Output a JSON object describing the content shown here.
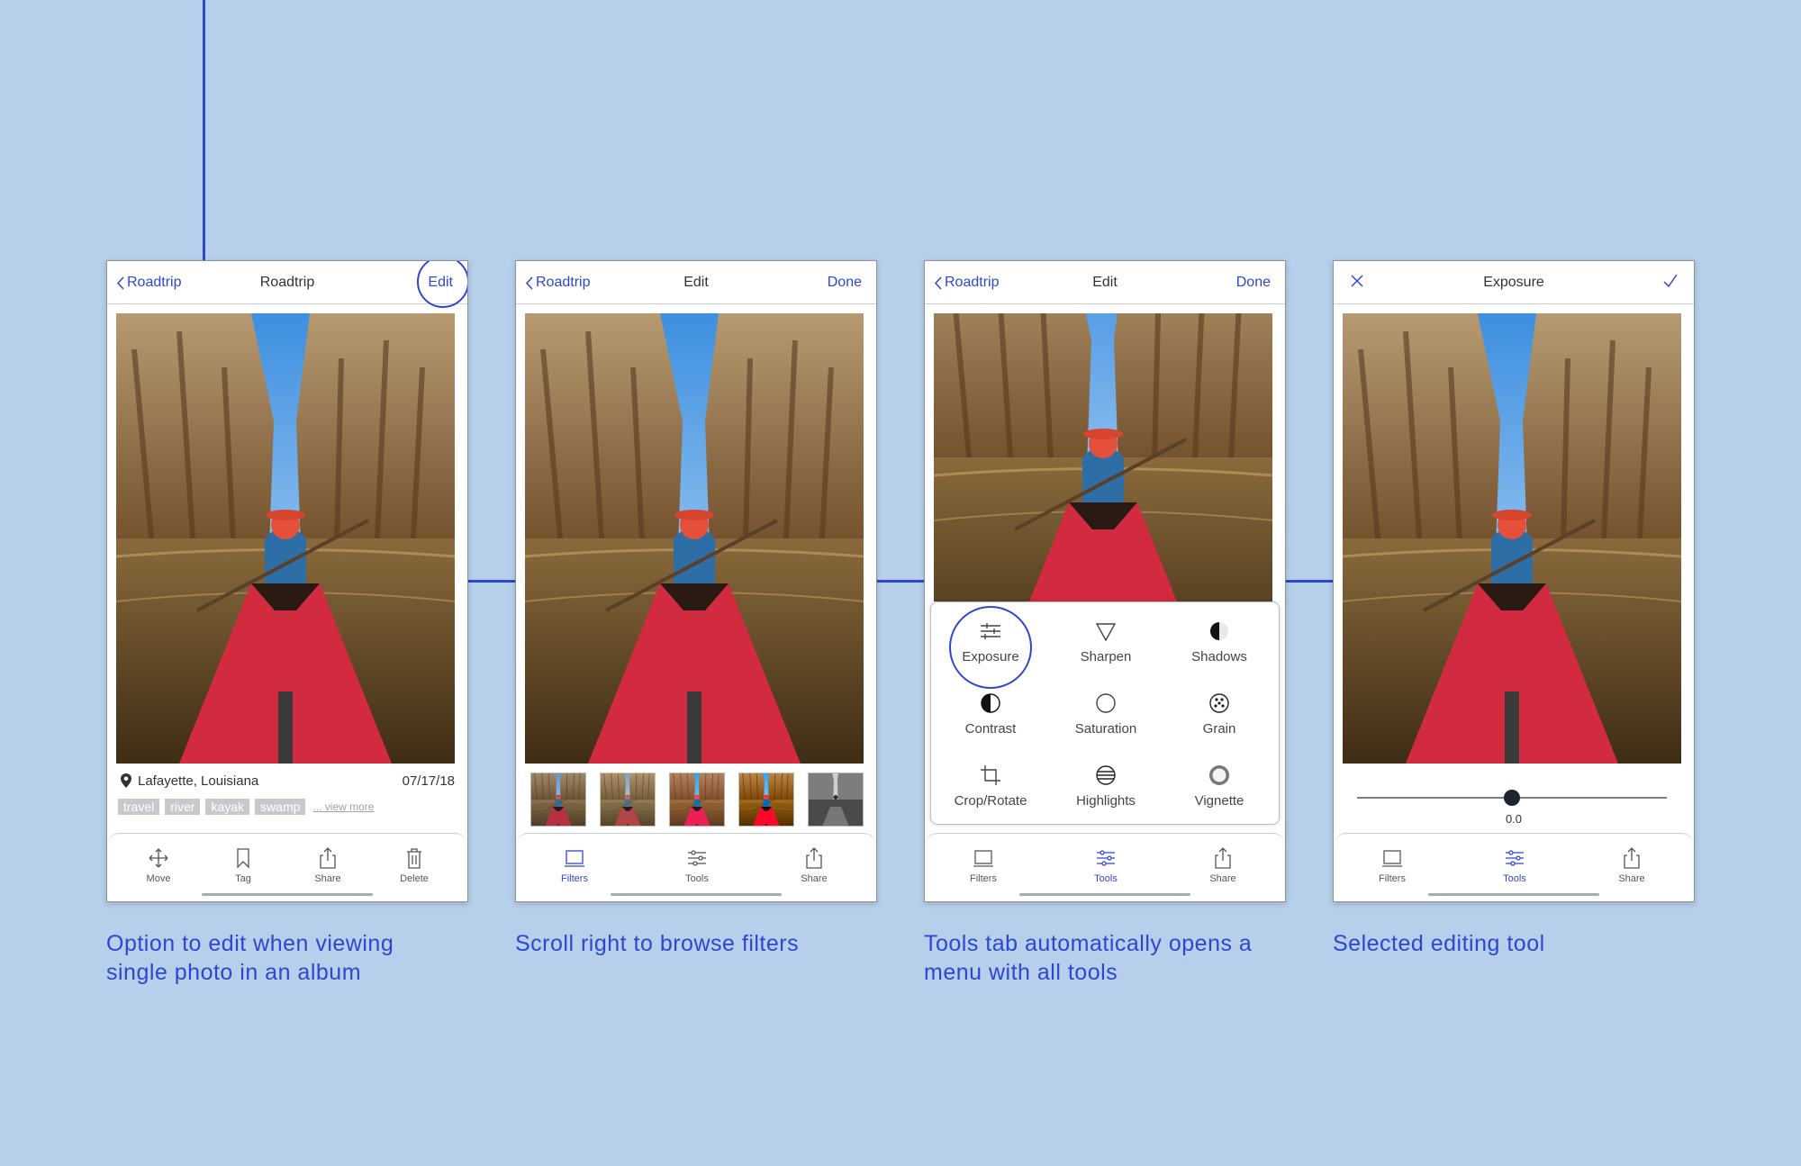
{
  "colors": {
    "background": "#b6cfea",
    "accent": "#2f46d0"
  },
  "screens": [
    {
      "nav": {
        "back": "Roadtrip",
        "title": "Roadtrip",
        "action": "Edit"
      },
      "location": "Lafayette, Louisiana",
      "date": "07/17/18",
      "tags": [
        "travel",
        "river",
        "kayak",
        "swamp"
      ],
      "view_more": "... view more",
      "tabs": [
        {
          "label": "Move",
          "icon": "move-icon"
        },
        {
          "label": "Tag",
          "icon": "bookmark-icon"
        },
        {
          "label": "Share",
          "icon": "share-icon"
        },
        {
          "label": "Delete",
          "icon": "trash-icon"
        }
      ],
      "caption": [
        "Option to edit when viewing",
        "single photo in an album"
      ]
    },
    {
      "nav": {
        "back": "Roadtrip",
        "title": "Edit",
        "action": "Done"
      },
      "filter_count": 5,
      "tabs": [
        {
          "label": "Filters",
          "icon": "filters-icon",
          "active": true
        },
        {
          "label": "Tools",
          "icon": "sliders-icon"
        },
        {
          "label": "Share",
          "icon": "share-icon"
        }
      ],
      "caption": [
        "Scroll right to browse filters"
      ]
    },
    {
      "nav": {
        "back": "Roadtrip",
        "title": "Edit",
        "action": "Done"
      },
      "tools": [
        {
          "label": "Exposure",
          "icon": "exposure-icon",
          "selected": true
        },
        {
          "label": "Sharpen",
          "icon": "triangle-icon"
        },
        {
          "label": "Shadows",
          "icon": "half-circle-icon"
        },
        {
          "label": "Contrast",
          "icon": "contrast-icon"
        },
        {
          "label": "Saturation",
          "icon": "circle-icon"
        },
        {
          "label": "Grain",
          "icon": "grain-icon"
        },
        {
          "label": "Crop/Rotate",
          "icon": "crop-icon"
        },
        {
          "label": "Highlights",
          "icon": "highlights-icon"
        },
        {
          "label": "Vignette",
          "icon": "vignette-icon"
        }
      ],
      "tabs": [
        {
          "label": "Filters",
          "icon": "filters-icon"
        },
        {
          "label": "Tools",
          "icon": "sliders-icon",
          "active": true
        },
        {
          "label": "Share",
          "icon": "share-icon"
        }
      ],
      "caption": [
        "Tools tab automatically opens a",
        "menu with all tools"
      ]
    },
    {
      "nav": {
        "title": "Exposure"
      },
      "slider": {
        "value_label": "0.0",
        "position": 0.5
      },
      "tabs": [
        {
          "label": "Filters",
          "icon": "filters-icon"
        },
        {
          "label": "Tools",
          "icon": "sliders-icon",
          "active": true
        },
        {
          "label": "Share",
          "icon": "share-icon"
        }
      ],
      "caption": [
        "Selected editing tool"
      ]
    }
  ]
}
